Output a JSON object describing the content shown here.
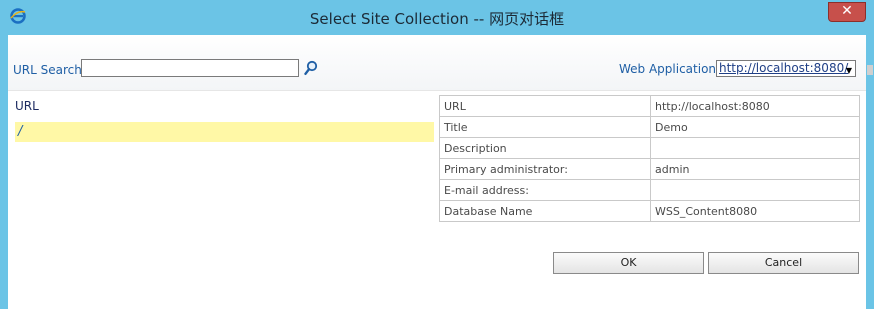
{
  "dialog": {
    "title": "Select Site Collection -- 网页对话框",
    "close_label": "✕"
  },
  "search": {
    "label": "URL Search",
    "value": "",
    "placeholder": ""
  },
  "web_application": {
    "label": "Web Application:",
    "selected": "http://localhost:8080/"
  },
  "list": {
    "header": "URL",
    "items": [
      {
        "label": "/"
      }
    ]
  },
  "details": {
    "rows": [
      {
        "key": "URL",
        "value": "http://localhost:8080"
      },
      {
        "key": "Title",
        "value": "Demo"
      },
      {
        "key": "Description",
        "value": ""
      },
      {
        "key": "Primary administrator:",
        "value": "admin"
      },
      {
        "key": "E-mail address:",
        "value": ""
      },
      {
        "key": "Database Name",
        "value": "WSS_Content8080"
      }
    ]
  },
  "buttons": {
    "ok": "OK",
    "cancel": "Cancel"
  },
  "colors": {
    "frame": "#6bc4e6",
    "link": "#1f5fa5",
    "selected_row": "#fff8a6",
    "close": "#c7504b"
  },
  "icons": {
    "app": "ie-icon",
    "search": "search-icon",
    "close": "close-icon",
    "dropdown": "chevron-down-icon"
  }
}
